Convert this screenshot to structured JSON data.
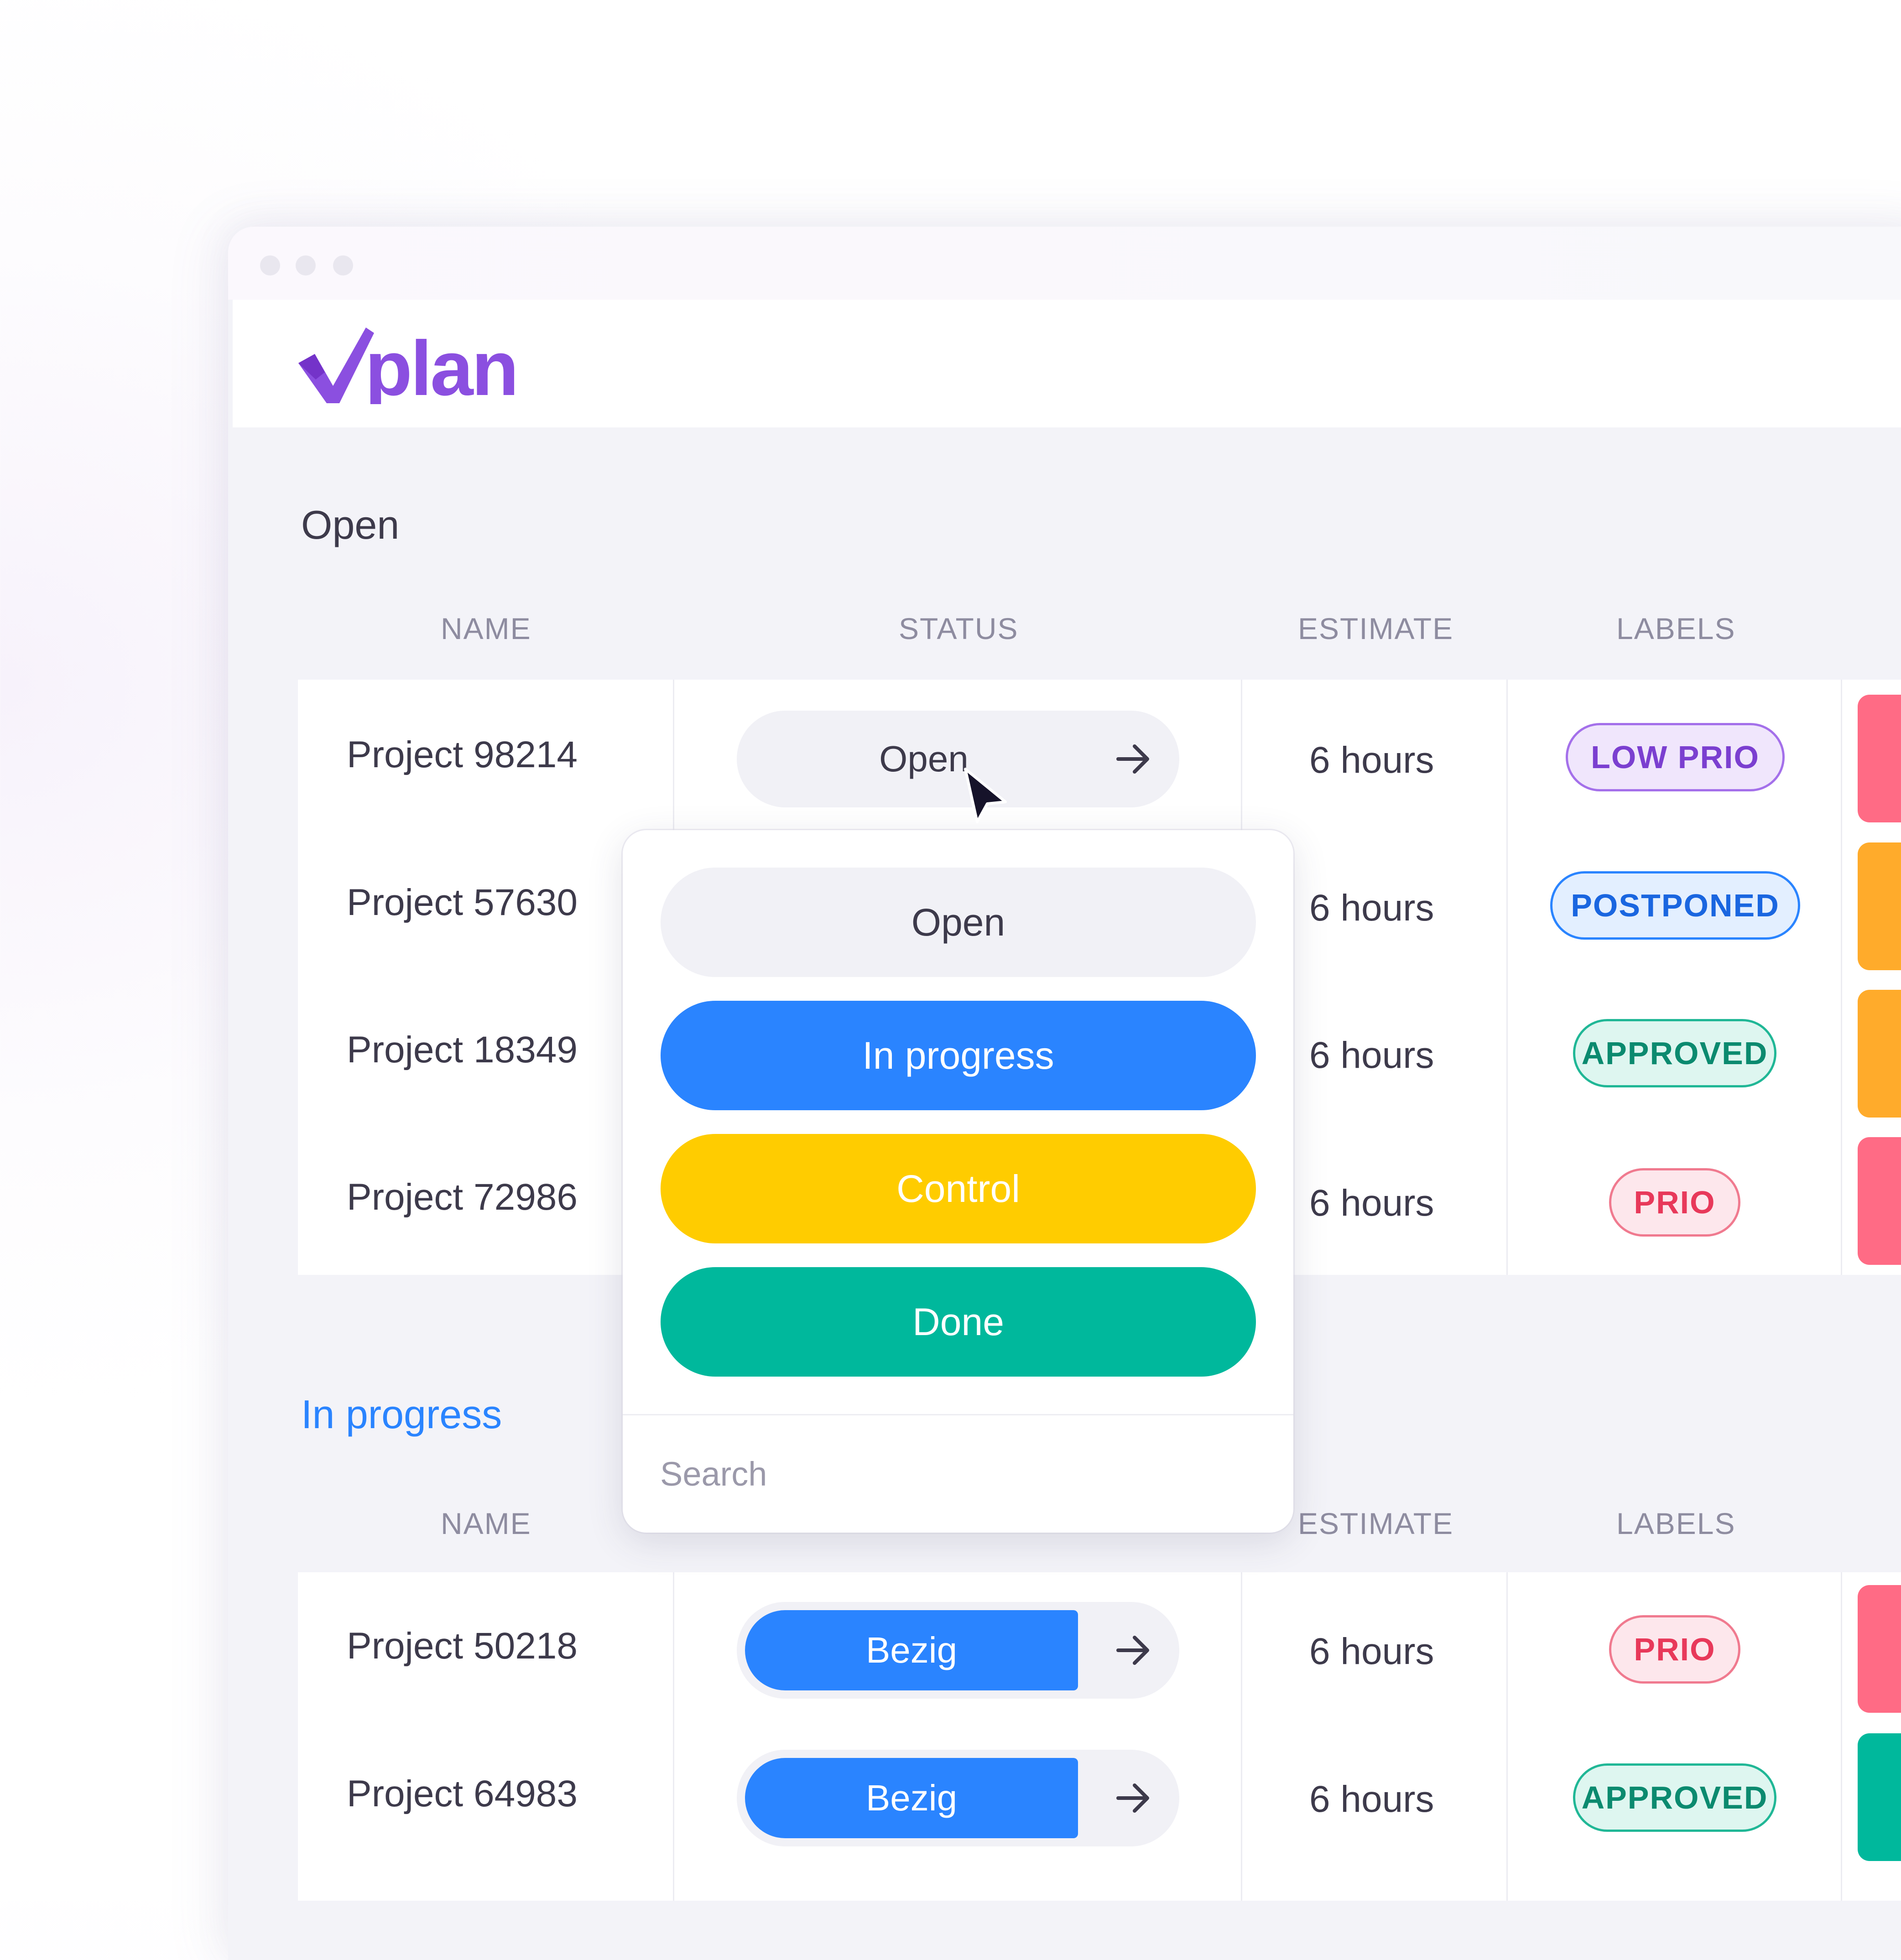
{
  "app": {
    "logo_text": "vplan",
    "brand_color": "#8b4fe0"
  },
  "sections": [
    {
      "title": "Open",
      "columns": [
        "NAME",
        "STATUS",
        "ESTIMATE",
        "LABELS"
      ],
      "rows": [
        {
          "name": "Project 98214",
          "status": "Open",
          "estimate": "6 hours",
          "label": "LOW PRIO"
        },
        {
          "name": "Project 57630",
          "estimate": "6 hours",
          "label": "POSTPONED"
        },
        {
          "name": "Project 18349",
          "estimate": "6 hours",
          "label": "APPROVED"
        },
        {
          "name": "Project 72986",
          "estimate": "6 hours",
          "label": "PRIO"
        }
      ]
    },
    {
      "title": "In progress",
      "columns": [
        "NAME",
        "ESTIMATE",
        "LABELS"
      ],
      "rows": [
        {
          "name": "Project 50218",
          "status": "Bezig",
          "estimate": "6 hours",
          "label": "PRIO"
        },
        {
          "name": "Project 64983",
          "status": "Bezig",
          "estimate": "6 hours",
          "label": "APPROVED"
        }
      ]
    }
  ],
  "status_dropdown": {
    "options": [
      "Open",
      "In progress",
      "Control",
      "Done"
    ],
    "search_placeholder": "Search"
  },
  "colors": {
    "open": "#f1f1f6",
    "in_progress": "#2a84ff",
    "control": "#ffcc00",
    "done": "#00b89c",
    "low_prio": "#8b4fe0",
    "postponed": "#1a66e0",
    "approved": "#0b8a6f",
    "prio": "#e8395a"
  }
}
